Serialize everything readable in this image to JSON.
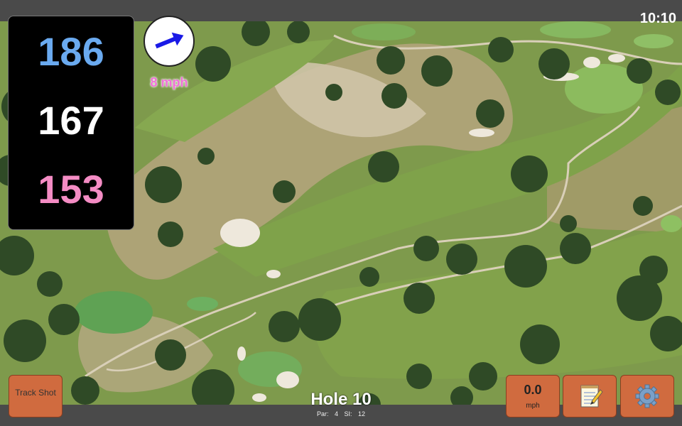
{
  "status": {
    "time": "10:10"
  },
  "yardage": {
    "back": "186",
    "center": "167",
    "front": "153"
  },
  "wind": {
    "speed_label": "8 mph",
    "direction_icon": "arrow-icon"
  },
  "hole": {
    "title": "Hole 10",
    "details": "Par: 4 SI: 12"
  },
  "buttons": {
    "track_shot": "Track Shot",
    "speed_value": "0.0",
    "speed_unit": "mph",
    "notes_icon": "notepad-icon",
    "settings_icon": "gear-icon"
  },
  "colors": {
    "back_yardage": "#6aaaf0",
    "center_yardage": "#ffffff",
    "front_yardage": "#f48cc4",
    "button_bg": "#d06b3f",
    "wind_text": "#f070d8"
  }
}
